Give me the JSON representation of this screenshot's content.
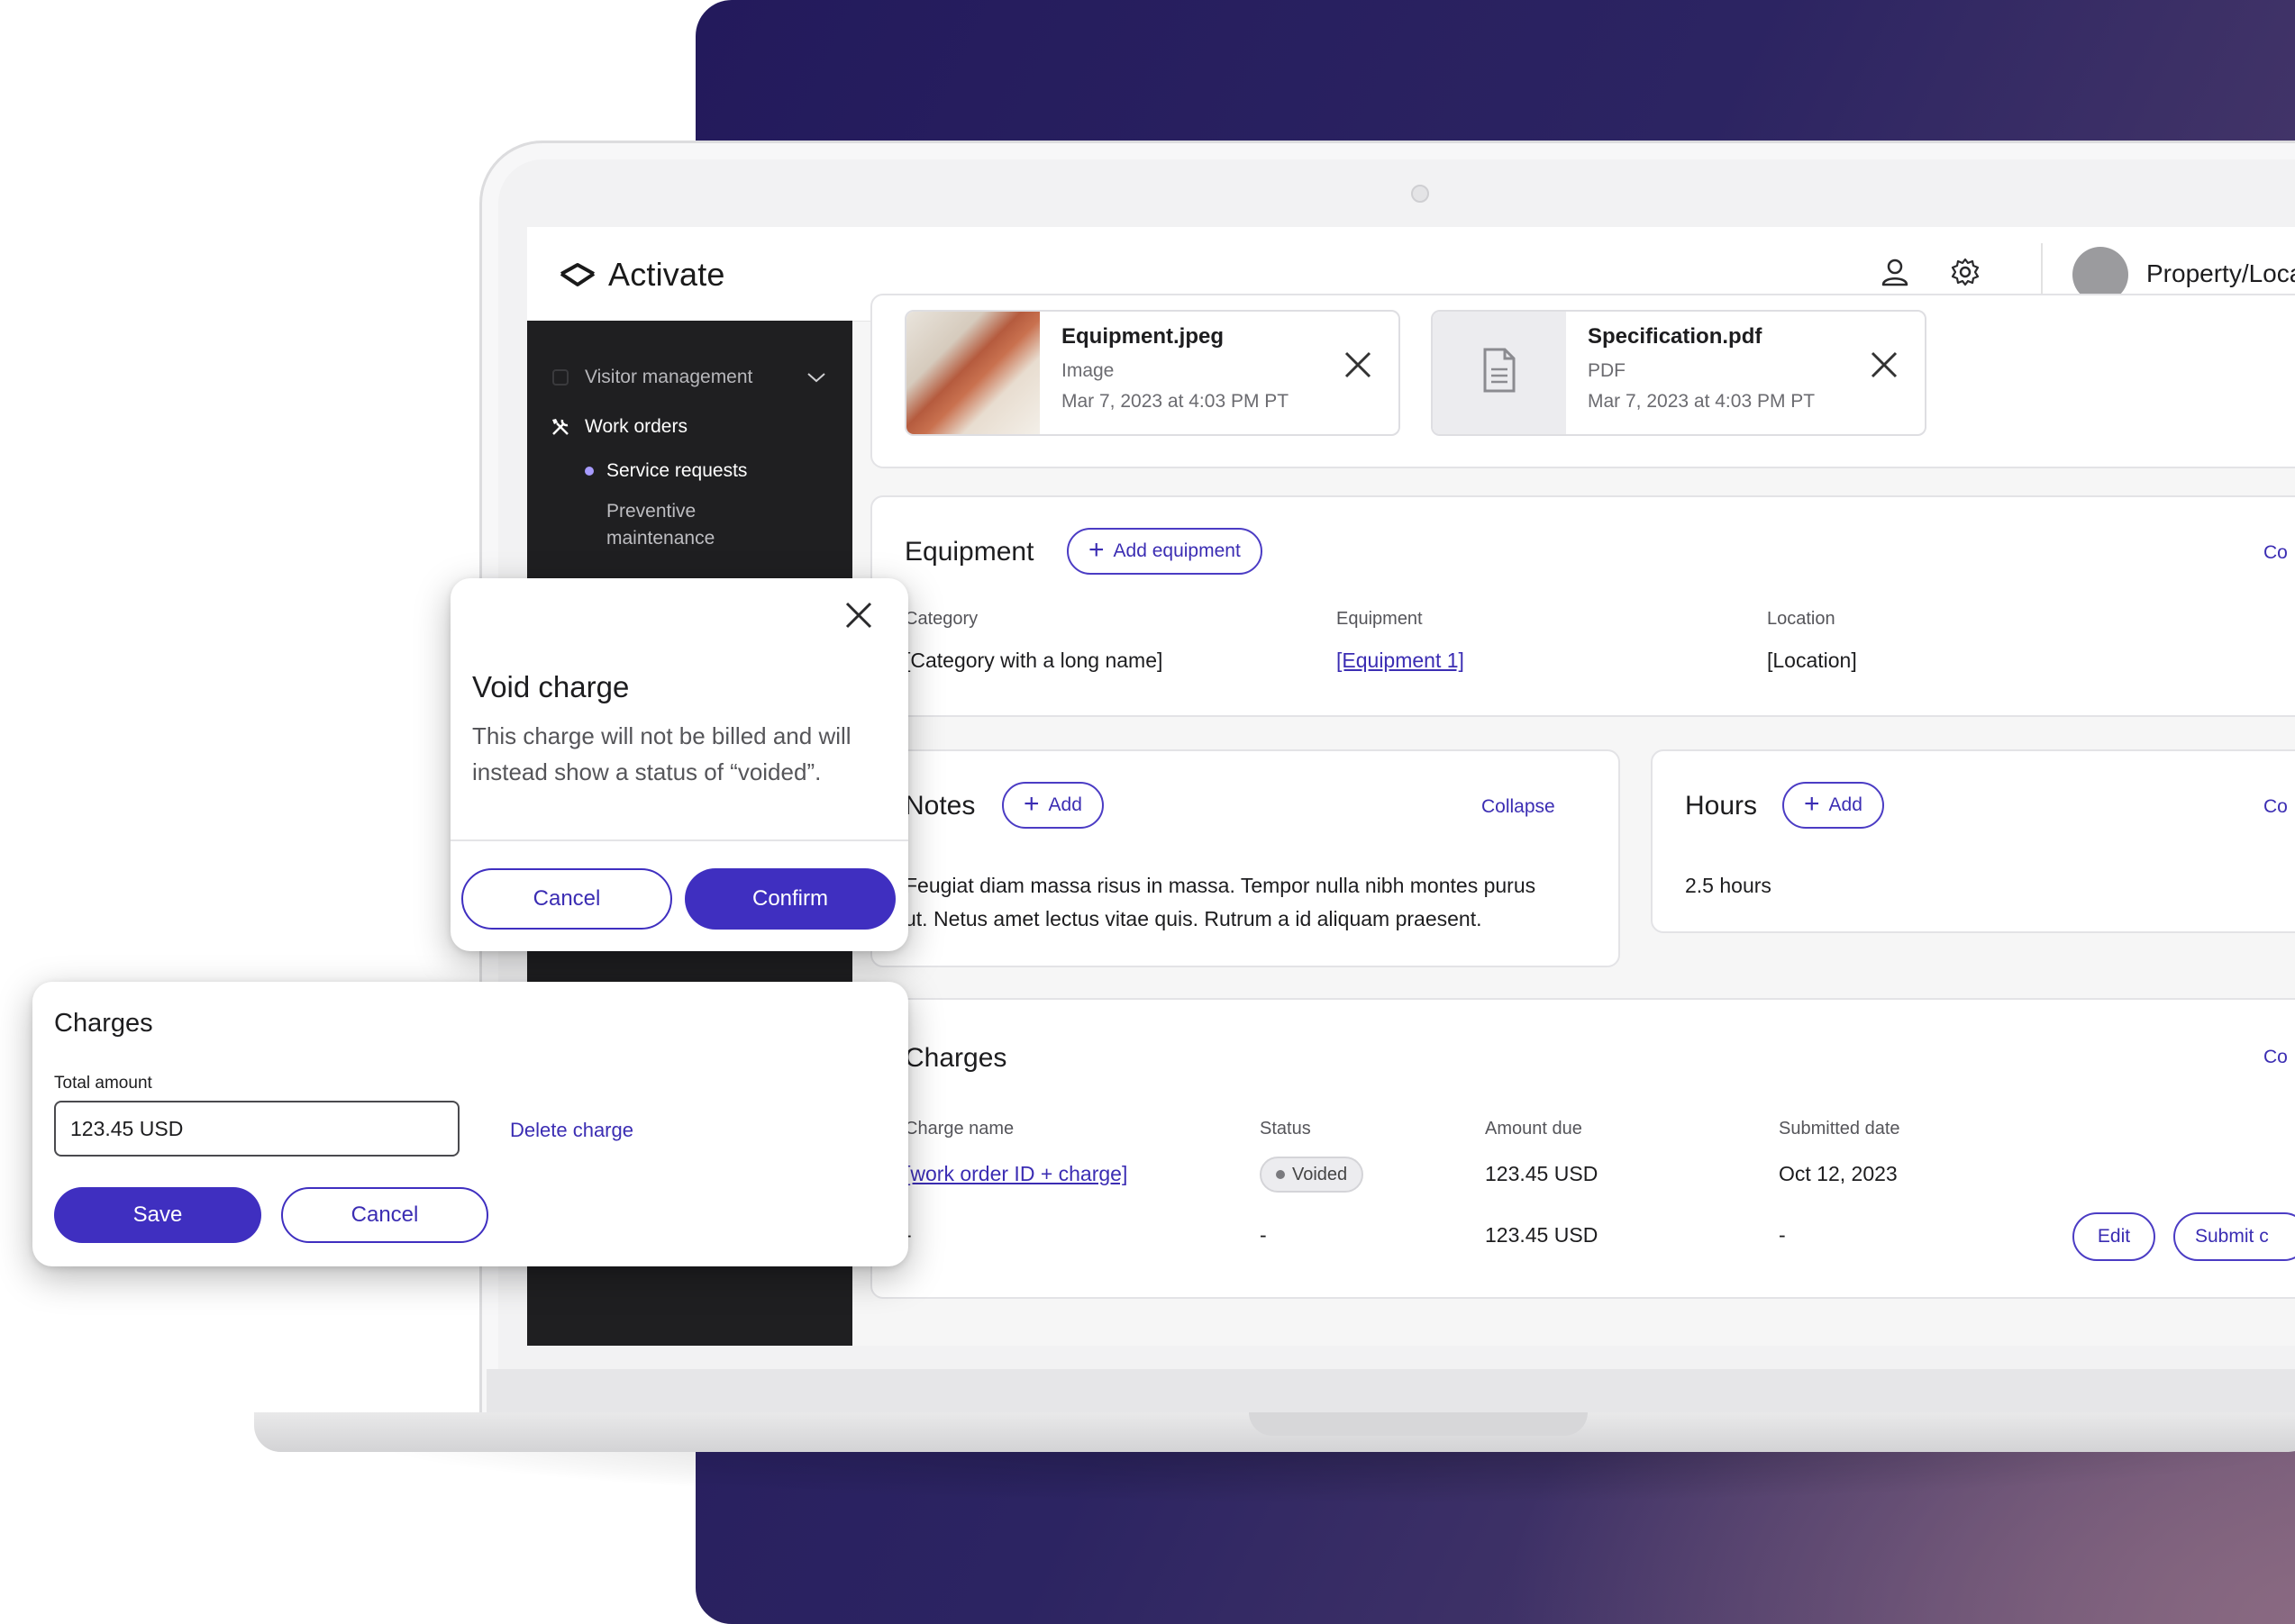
{
  "app": {
    "brand": "Activate",
    "property_label": "Property/Loca"
  },
  "sidebar": {
    "items": [
      {
        "label": "Visitor management",
        "icon": "visitor-icon",
        "expanded": false
      },
      {
        "label": "Work orders",
        "icon": "tools-icon"
      },
      {
        "label": "Service requests",
        "active": true
      },
      {
        "label": "Preventive",
        "label2": "maintenance"
      }
    ]
  },
  "attachments": [
    {
      "name": "Equipment.jpeg",
      "type": "Image",
      "date": "Mar 7, 2023 at 4:03 PM PT",
      "thumb": "photo"
    },
    {
      "name": "Specification.pdf",
      "type": "PDF",
      "date": "Mar 7, 2023 at 4:03 PM PT",
      "thumb": "document-icon"
    }
  ],
  "equipment": {
    "title": "Equipment",
    "add_label": "Add equipment",
    "collapse_label": "Co",
    "columns": [
      "Category",
      "Equipment",
      "Location"
    ],
    "values": [
      "[Category with a long name]",
      "[Equipment 1]",
      "[Location]"
    ]
  },
  "notes": {
    "title": "Notes",
    "add_label": "Add",
    "collapse_label": "Collapse",
    "text_line1": "Feugiat diam massa risus in massa. Tempor nulla nibh montes purus",
    "text_line2": "ut. Netus amet lectus vitae quis. Rutrum a id aliquam praesent."
  },
  "hours": {
    "title": "Hours",
    "add_label": "Add",
    "collapse_label": "Co",
    "value": "2.5 hours"
  },
  "charges": {
    "title": "Charges",
    "collapse_label": "Co",
    "columns": [
      "Charge name",
      "Status",
      "Amount due",
      "Submitted date"
    ],
    "rows": [
      {
        "name": "[work order ID + charge]",
        "status": "Voided",
        "amount": "123.45 USD",
        "date": "Oct 12, 2023"
      },
      {
        "name": "-",
        "status": "-",
        "amount": "123.45 USD",
        "date": "-",
        "edit_label": "Edit",
        "submit_label": "Submit c"
      }
    ]
  },
  "void_modal": {
    "title": "Void charge",
    "body_line1": "This charge will not be billed and will",
    "body_line2": "instead show a status of “voided”.",
    "cancel_label": "Cancel",
    "confirm_label": "Confirm"
  },
  "charges_modal": {
    "title": "Charges",
    "field_label": "Total amount",
    "field_value": "123.45 USD",
    "delete_label": "Delete charge",
    "save_label": "Save",
    "cancel_label": "Cancel"
  },
  "colors": {
    "accent": "#3f2fc0",
    "sidebar_bg": "#1f1f21",
    "background_gradient_start": "#231a5c",
    "background_gradient_end": "#6d5474"
  }
}
